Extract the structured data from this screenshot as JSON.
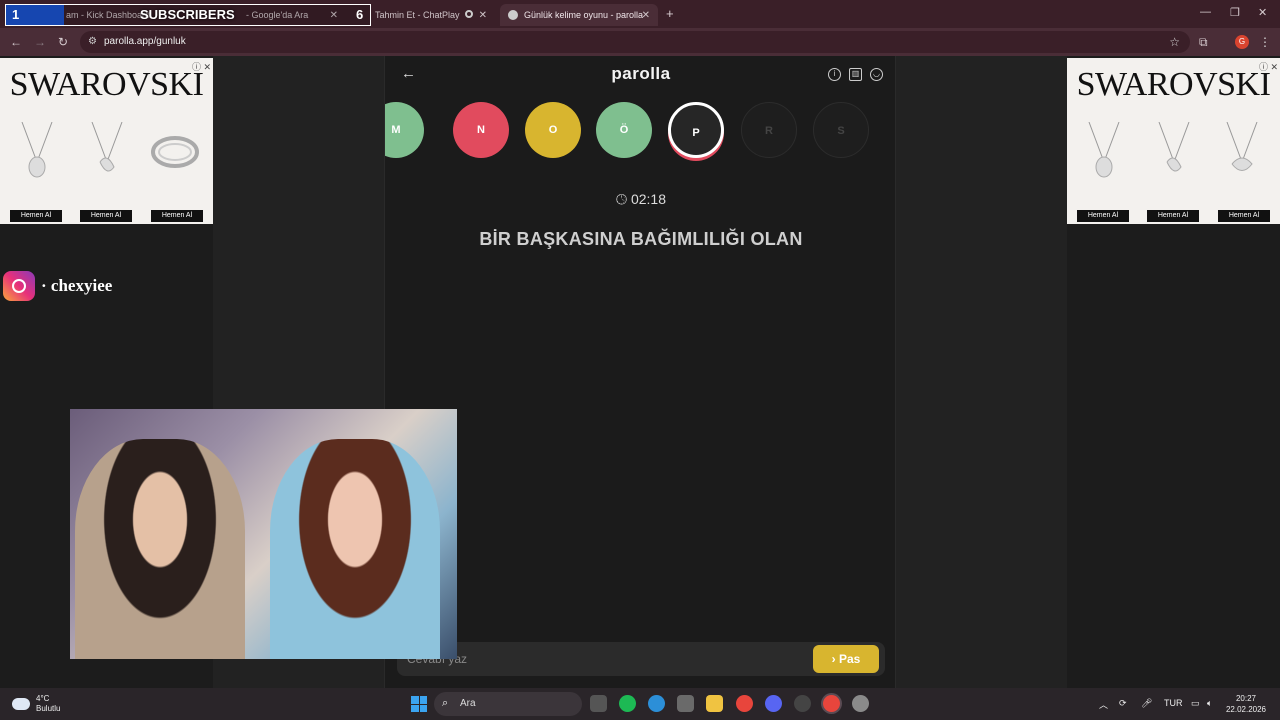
{
  "browser": {
    "tabs": [
      {
        "label": "am - Kick Dashboard",
        "active": false
      },
      {
        "label": "- Google'da Ara",
        "active": false
      },
      {
        "label": "Tahmin Et - ChatPlay",
        "active": false
      },
      {
        "label": "Günlük kelime oyunu - parolla",
        "active": true
      }
    ],
    "new_tab": "+",
    "url": "parolla.app/gunluk",
    "profile_initial": "G"
  },
  "overlay": {
    "left_number": "1",
    "label": "SUBSCRIBERS",
    "right_number": "6"
  },
  "ads": {
    "brand": "SWAROVSKI",
    "button_label": "Hemen Al"
  },
  "instagram": {
    "handle": "· chexyiee"
  },
  "game": {
    "title": "parolla",
    "letters": [
      {
        "char": "M",
        "color": "#7fbf8f"
      },
      {
        "char": "N",
        "color": "#e14b5e"
      },
      {
        "char": "O",
        "color": "#d8b52f"
      },
      {
        "char": "Ö",
        "color": "#7fbf8f"
      },
      {
        "char": "P",
        "color": "#262626"
      },
      {
        "char": "R",
        "color": "#1e1e1e"
      },
      {
        "char": "S",
        "color": "#1e1e1e"
      }
    ],
    "timer": "02:18",
    "question": "BİR BAŞKASINA BAĞIMLILIĞI OLAN",
    "answer_placeholder": "Cevabı yaz",
    "pass_button": "Pas"
  },
  "taskbar": {
    "weather_temp": "4°C",
    "weather_desc": "Bulutlu",
    "search_placeholder": "Ara",
    "language": "TUR",
    "time": "20:27",
    "date": "22.02.2026"
  }
}
